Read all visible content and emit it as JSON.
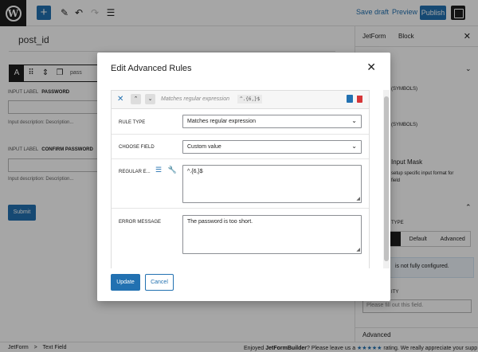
{
  "topbar": {
    "logo_char": "W",
    "add_icon": "+",
    "save_draft": "Save draft",
    "preview": "Preview",
    "publish": "Publish"
  },
  "canvas": {
    "post_id": "post_id",
    "block_toolbar_field": "pass",
    "password_field_label_prefix": "INPUT LABEL",
    "password_label": "PASSWORD",
    "password_desc": "Input description: Description...",
    "confirm_label_prefix": "INPUT LABEL",
    "confirm_label": "CONFIRM PASSWORD",
    "confirm_desc": "Input description: Description...",
    "submit": "Submit"
  },
  "sidebar": {
    "tab_jetform": "JetForm",
    "tab_block": "Block",
    "length_symbols_1": "(SYMBOLS)",
    "length_symbols_2": "(SYMBOLS)",
    "input_mask": "Input Mask",
    "input_mask_help_1": "setup specific input format for",
    "input_mask_help_2": "field",
    "type_label": "TYPE",
    "seg_default": "Default",
    "seg_advanced": "Advanced",
    "notice": "is not fully configured.",
    "validity_label": "ITY",
    "message_placeholder": "Please fill out this field.",
    "advanced": "Advanced"
  },
  "footer": {
    "breadcrumb_1": "JetForm",
    "breadcrumb_sep": ">",
    "breadcrumb_2": "Text Field",
    "note_prefix": "Enjoyed ",
    "note_brand": "JetFormBuilder",
    "note_mid": "? Please leave us a ",
    "note_stars": "★★★★★",
    "note_suffix": " rating. We really appreciate your supp"
  },
  "modal": {
    "title": "Edit Advanced Rules",
    "rule_title": "Matches regular expression",
    "rule_code": "^.{6,}$",
    "rule_type_label": "RULE TYPE",
    "rule_type_value": "Matches regular expression",
    "choose_field_label": "CHOOSE FIELD",
    "choose_field_value": "Custom value",
    "regex_label": "REGULAR E...",
    "regex_value": "^.{6,}$",
    "error_label": "ERROR MESSAGE",
    "error_value": "The password is too short.",
    "update": "Update",
    "cancel": "Cancel"
  }
}
